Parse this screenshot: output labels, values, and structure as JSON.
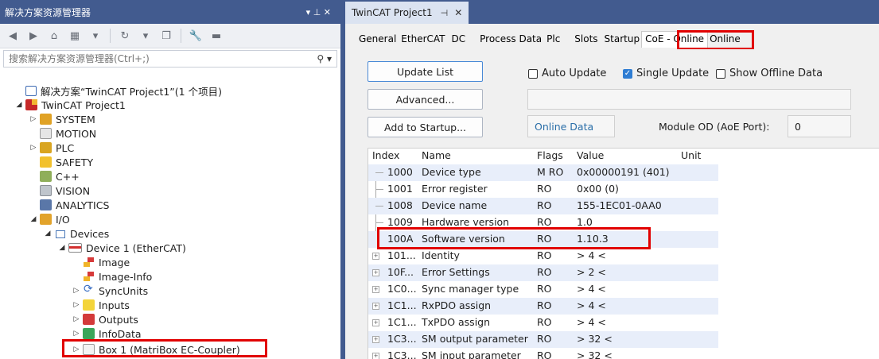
{
  "left_panel": {
    "title": "解决方案资源管理器",
    "title_controls": "▾ ⊥ ✕",
    "search_placeholder": "搜索解决方案资源管理器(Ctrl+;)",
    "tree": [
      {
        "label": "解决方案“TwinCAT Project1”(1 个项目)",
        "icon": "solution-icon",
        "expander": ""
      },
      {
        "label": "TwinCAT Project1",
        "icon": "twincat-project-icon",
        "expander": "◢"
      },
      {
        "label": "SYSTEM",
        "icon": "system-icon",
        "expander": "▷"
      },
      {
        "label": "MOTION",
        "icon": "motion-icon",
        "expander": ""
      },
      {
        "label": "PLC",
        "icon": "plc-icon",
        "expander": "▷"
      },
      {
        "label": "SAFETY",
        "icon": "safety-icon",
        "expander": ""
      },
      {
        "label": "C++",
        "icon": "cpp-icon",
        "expander": ""
      },
      {
        "label": "VISION",
        "icon": "vision-icon",
        "expander": ""
      },
      {
        "label": "ANALYTICS",
        "icon": "analytics-icon",
        "expander": ""
      },
      {
        "label": "I/O",
        "icon": "io-icon",
        "expander": "◢"
      },
      {
        "label": "Devices",
        "icon": "devices-icon",
        "expander": "◢"
      },
      {
        "label": "Device 1 (EtherCAT)",
        "icon": "ethercat-device-icon",
        "expander": "◢"
      },
      {
        "label": "Image",
        "icon": "image-icon",
        "expander": ""
      },
      {
        "label": "Image-Info",
        "icon": "image-info-icon",
        "expander": ""
      },
      {
        "label": "SyncUnits",
        "icon": "syncunits-icon",
        "expander": "▷"
      },
      {
        "label": "Inputs",
        "icon": "inputs-icon",
        "expander": "▷"
      },
      {
        "label": "Outputs",
        "icon": "outputs-icon",
        "expander": "▷"
      },
      {
        "label": "InfoData",
        "icon": "infodata-icon",
        "expander": "▷"
      },
      {
        "label": "Box 1 (MatriBox EC-Coupler)",
        "icon": "box-icon",
        "expander": "▷"
      }
    ]
  },
  "document": {
    "tab_title": "TwinCAT Project1",
    "tab_pin": "⊣",
    "tab_close": "✕",
    "property_tabs": [
      "General",
      "EtherCAT",
      "DC",
      "Process Data",
      "Plc",
      "Slots",
      "Startup",
      "CoE - Online",
      "Online"
    ],
    "active_tab": "CoE - Online",
    "update_list": "Update List",
    "advanced": "Advanced...",
    "add_to_startup": "Add to Startup...",
    "auto_update": "Auto Update",
    "single_update": "Single Update",
    "show_offline": "Show Offline Data",
    "online_data": "Online Data",
    "module_od_label": "Module OD (AoE Port):",
    "module_od_value": "0",
    "columns": [
      "Index",
      "Name",
      "Flags",
      "Value",
      "Unit"
    ],
    "rows": [
      {
        "index": "1000",
        "name": "Device type",
        "flags": "M RO",
        "value": "0x00000191 (401)",
        "expandable": false
      },
      {
        "index": "1001",
        "name": "Error register",
        "flags": "RO",
        "value": "0x00 (0)",
        "expandable": false
      },
      {
        "index": "1008",
        "name": "Device name",
        "flags": "RO",
        "value": "155-1EC01-0AA0",
        "expandable": false
      },
      {
        "index": "1009",
        "name": "Hardware version",
        "flags": "RO",
        "value": "1.0",
        "expandable": false
      },
      {
        "index": "100A",
        "name": "Software version",
        "flags": "RO",
        "value": "1.10.3",
        "expandable": false
      },
      {
        "index": "101...",
        "name": "Identity",
        "flags": "RO",
        "value": "> 4 <",
        "expandable": true
      },
      {
        "index": "10F...",
        "name": "Error Settings",
        "flags": "RO",
        "value": "> 2 <",
        "expandable": true
      },
      {
        "index": "1C0...",
        "name": "Sync manager type",
        "flags": "RO",
        "value": "> 4 <",
        "expandable": true
      },
      {
        "index": "1C1...",
        "name": "RxPDO assign",
        "flags": "RO",
        "value": "> 4 <",
        "expandable": true
      },
      {
        "index": "1C1...",
        "name": "TxPDO assign",
        "flags": "RO",
        "value": "> 4 <",
        "expandable": true
      },
      {
        "index": "1C3...",
        "name": "SM output parameter",
        "flags": "RO",
        "value": "> 32 <",
        "expandable": true
      },
      {
        "index": "1C3...",
        "name": "SM input parameter",
        "flags": "RO",
        "value": "> 32 <",
        "expandable": true
      }
    ]
  },
  "colors": {
    "titlebar": "#425b8f",
    "highlight": "#e10000",
    "row_shade": "#e8eefa",
    "checkbox_on": "#2f7dd3"
  }
}
